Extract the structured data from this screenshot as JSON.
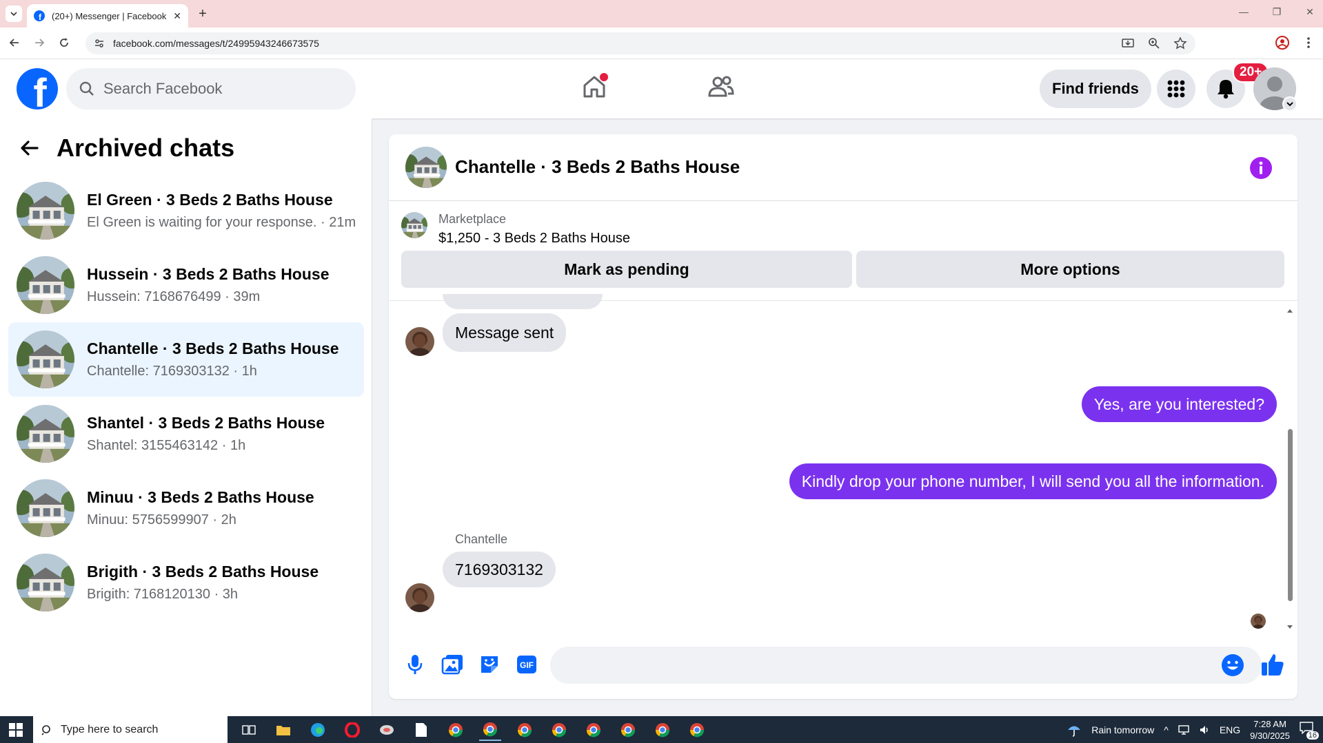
{
  "browser": {
    "tab_title": "(20+) Messenger | Facebook",
    "url": "facebook.com/messages/t/24995943246673575"
  },
  "header": {
    "search_placeholder": "Search Facebook",
    "find_friends_label": "Find friends",
    "notification_count": "20+"
  },
  "sidebar": {
    "title": "Archived chats",
    "chats": [
      {
        "name": "El Green · 3 Beds 2 Baths House",
        "snippet": "El Green is waiting for your response. · 21m",
        "active": false
      },
      {
        "name": "Hussein · 3 Beds 2 Baths House",
        "snippet": "Hussein: 7168676499 · 39m",
        "active": false
      },
      {
        "name": "Chantelle · 3 Beds 2 Baths House",
        "snippet": "Chantelle: 7169303132 · 1h",
        "active": true
      },
      {
        "name": "Shantel · 3 Beds 2 Baths House",
        "snippet": "Shantel: 3155463142 · 1h",
        "active": false
      },
      {
        "name": "Minuu · 3 Beds 2 Baths House",
        "snippet": "Minuu: 5756599907 · 2h",
        "active": false
      },
      {
        "name": "Brigith · 3 Beds 2 Baths House",
        "snippet": "Brigith: 7168120130 · 3h",
        "active": false
      }
    ]
  },
  "conversation": {
    "title": "Chantelle · 3 Beds 2 Baths House",
    "marketplace_label": "Marketplace",
    "listing": "$1,250 - 3 Beds 2 Baths House",
    "mark_pending_label": "Mark as pending",
    "more_options_label": "More options",
    "messages": {
      "in1": "Message sent",
      "out1": "Yes, are you interested?",
      "out2": "Kindly drop your phone number, I will send you all the information.",
      "sender_name": "Chantelle",
      "in2": "7169303132"
    },
    "gif_label": "GIF"
  },
  "taskbar": {
    "search_placeholder": "Type here to search",
    "weather": "Rain tomorrow",
    "lang": "ENG",
    "time": "7:28 AM",
    "date": "9/30/2025",
    "notif_count": "16"
  },
  "colors": {
    "fb_blue": "#0866ff",
    "outgoing_bubble": "#7a32ef",
    "incoming_bubble": "#e4e6eb",
    "active_chat_bg": "#ebf5ff"
  }
}
